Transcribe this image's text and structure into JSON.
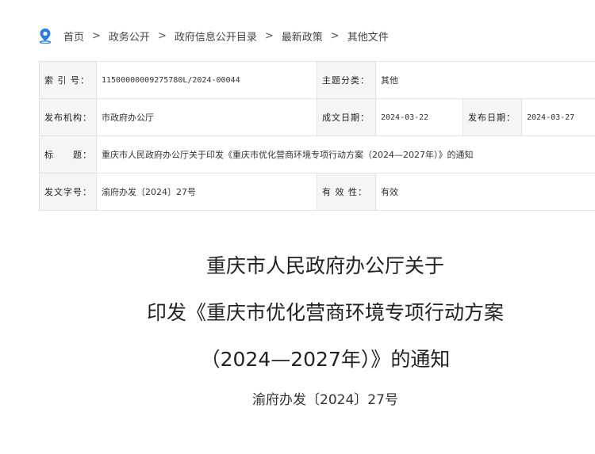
{
  "breadcrumb": {
    "items": [
      "首页",
      "政务公开",
      "政府信息公开目录",
      "最新政策",
      "其他文件"
    ],
    "separator": ">"
  },
  "meta": {
    "index_label": "索 引 号：",
    "index_value": "11500000009275780L/2024-00044",
    "topic_label": "主题分类：",
    "topic_value": "其他",
    "publisher_label": "发布机构：",
    "publisher_value": "市政府办公厅",
    "written_label": "成文日期：",
    "written_value": "2024-03-22",
    "release_label": "发布日期：",
    "release_value": "2024-03-27",
    "title_label": "标　　题：",
    "title_value": "重庆市人民政府办公厅关于印发《重庆市优化营商环境专项行动方案（2024—2027年）》的通知",
    "doc_no_label": "发文字号：",
    "doc_no_value": "渝府办发〔2024〕27号",
    "validity_label": "有 效 性：",
    "validity_value": "有效"
  },
  "document": {
    "title_line1": "重庆市人民政府办公厅关于",
    "title_line2": "印发《重庆市优化营商环境专项行动方案",
    "title_line3": "（2024—2027年）》的通知",
    "doc_number": "渝府办发〔2024〕27号"
  },
  "colors": {
    "icon_blue": "#2b7de0",
    "label_bg": "#f5f5f5",
    "border": "#e3e3e3"
  }
}
